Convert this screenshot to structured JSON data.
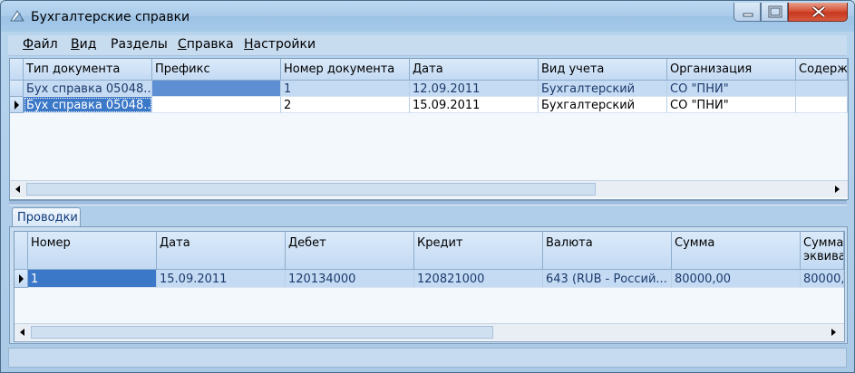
{
  "window": {
    "title": "Бухгалтерские справки"
  },
  "menu": [
    {
      "underlined": "Ф",
      "rest": "айл"
    },
    {
      "underlined": "В",
      "rest": "ид"
    },
    {
      "underlined": "",
      "rest": "Разделы"
    },
    {
      "underlined": "С",
      "rest": "правка"
    },
    {
      "underlined": "Н",
      "rest": "астройки"
    }
  ],
  "top_grid": {
    "columns": [
      "Тип документа",
      "Префикс",
      "Номер документа",
      "Дата",
      "Вид учета",
      "Организация",
      "Содержа"
    ],
    "rows": [
      [
        "Бух справка 05048...",
        "",
        "1",
        "12.09.2011",
        "Бухгалтерский",
        "СО \"ПНИ\"",
        ""
      ],
      [
        "Бух справка 05048...",
        "",
        "2",
        "15.09.2011",
        "Бухгалтерский",
        "СО \"ПНИ\"",
        ""
      ]
    ],
    "scroll_position": 0.0
  },
  "tabs": {
    "active": "Проводки"
  },
  "bottom_grid": {
    "columns": [
      {
        "line1": "Номер",
        "line2": ""
      },
      {
        "line1": "Дата",
        "line2": ""
      },
      {
        "line1": "Дебет",
        "line2": ""
      },
      {
        "line1": "Кредит",
        "line2": ""
      },
      {
        "line1": "Валюта",
        "line2": ""
      },
      {
        "line1": "Сумма",
        "line2": ""
      },
      {
        "line1": "Сумма",
        "line2": "эквива"
      }
    ],
    "rows": [
      [
        "1",
        "15.09.2011",
        "120134000",
        "120821000",
        "643 (RUB - Россий...",
        "80000,00",
        "80000,"
      ]
    ],
    "scroll_position": 0.0
  },
  "colors": {
    "selection": "#3c78c8",
    "row_highlight": "#c5dbf4",
    "close_button": "#c7371f"
  }
}
